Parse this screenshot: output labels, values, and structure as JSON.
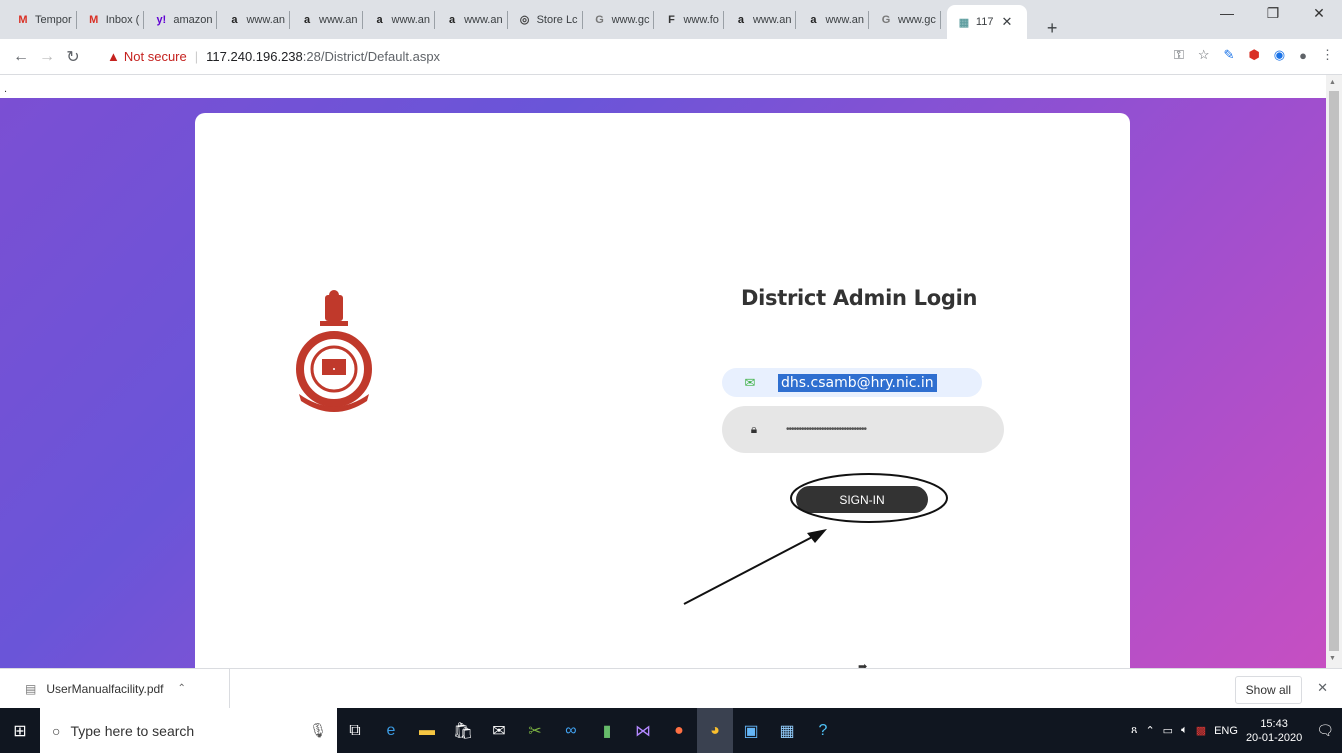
{
  "browser": {
    "tabs": [
      {
        "label": "Tempor",
        "icon": "gmail-icon",
        "glyph": "M",
        "color": "#d93025"
      },
      {
        "label": "Inbox (",
        "icon": "gmail-icon",
        "glyph": "M",
        "color": "#d93025"
      },
      {
        "label": "amazon",
        "icon": "yahoo-icon",
        "glyph": "y!",
        "color": "#6001d2"
      },
      {
        "label": "www.an",
        "icon": "amazon-icon",
        "glyph": "a",
        "color": "#222"
      },
      {
        "label": "www.an",
        "icon": "amazon-icon",
        "glyph": "a",
        "color": "#222"
      },
      {
        "label": "www.an",
        "icon": "amazon-icon",
        "glyph": "a",
        "color": "#222"
      },
      {
        "label": "www.an",
        "icon": "amazon-icon",
        "glyph": "a",
        "color": "#222"
      },
      {
        "label": "Store Lc",
        "icon": "globe-icon",
        "glyph": "◎",
        "color": "#444"
      },
      {
        "label": "www.gc",
        "icon": "google-icon",
        "glyph": "G",
        "color": "#777"
      },
      {
        "label": "www.fo",
        "icon": "fusion-icon",
        "glyph": "F",
        "color": "#333"
      },
      {
        "label": "www.an",
        "icon": "amazon-icon",
        "glyph": "a",
        "color": "#222"
      },
      {
        "label": "www.an",
        "icon": "amazon-icon",
        "glyph": "a",
        "color": "#222"
      },
      {
        "label": "www.gc",
        "icon": "google-icon",
        "glyph": "G",
        "color": "#777"
      }
    ],
    "active_tab": "117",
    "url_warning": "Not secure",
    "url_host": "117.240.196.238",
    "url_path": ":28/District/Default.aspx"
  },
  "page": {
    "title": "District Admin Login",
    "email_value": "dhs.csamb@hry.nic.in",
    "password_mask": "••••••••••••••••••••••••••••••••",
    "signin_label": "SIGN-IN",
    "dot": "."
  },
  "downloads": {
    "file": "UserManualfacility.pdf",
    "show_all": "Show all"
  },
  "taskbar": {
    "search_placeholder": "Type here to search",
    "lang": "ENG",
    "time": "15:43",
    "date": "20-01-2020"
  },
  "colors": {
    "accent": "#333333",
    "gradient_start": "#7b4fd3",
    "gradient_end": "#c64fc2",
    "warning": "#c5221f"
  }
}
